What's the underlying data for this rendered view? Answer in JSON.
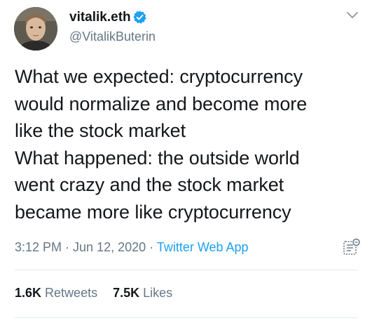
{
  "author": {
    "display_name": "vitalik.eth",
    "handle": "@VitalikButerin",
    "verified": true,
    "avatar_icon": "profile-avatar",
    "verified_icon": "verified-badge-icon",
    "verified_color": "#1da1f2"
  },
  "menu": {
    "icon": "chevron-down-icon"
  },
  "tweet": {
    "lines": [
      "What we expected: cryptocurrency",
      "would normalize and become more",
      "like the stock market",
      "What happened: the outside world",
      "went crazy and the stock market",
      "became more like cryptocurrency"
    ]
  },
  "meta": {
    "time": "3:12 PM",
    "separator": " · ",
    "date": "Jun 12, 2020",
    "source": "Twitter Web App",
    "source_color": "#1da1f2",
    "analytics_icon": "analytics-icon"
  },
  "stats": {
    "retweets_count": "1.6K",
    "retweets_label": "Retweets",
    "likes_count": "7.5K",
    "likes_label": "Likes"
  },
  "colors": {
    "text": "#14171a",
    "secondary": "#657786",
    "accent": "#1da1f2",
    "divider": "#e1e8ed"
  }
}
